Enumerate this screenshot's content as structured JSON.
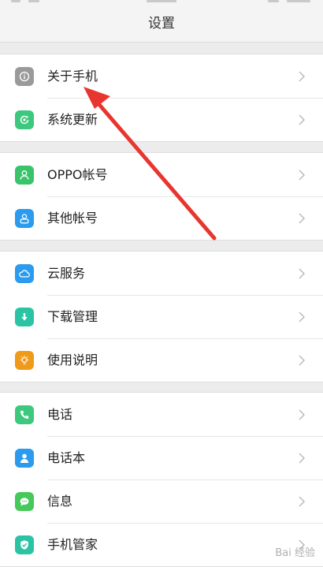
{
  "header": {
    "title": "设置"
  },
  "groups": [
    {
      "items": [
        {
          "label": "关于手机",
          "icon": "info-icon",
          "color": "#9a9a9a"
        },
        {
          "label": "系统更新",
          "icon": "update-icon",
          "color": "#3cc87d"
        }
      ]
    },
    {
      "items": [
        {
          "label": "OPPO帐号",
          "icon": "person-icon",
          "color": "#39c36b"
        },
        {
          "label": "其他帐号",
          "icon": "account-icon",
          "color": "#2a9bee"
        }
      ]
    },
    {
      "items": [
        {
          "label": "云服务",
          "icon": "cloud-icon",
          "color": "#2a9bee"
        },
        {
          "label": "下载管理",
          "icon": "download-icon",
          "color": "#2ac4a4"
        },
        {
          "label": "使用说明",
          "icon": "bulb-icon",
          "color": "#f09a1a"
        }
      ]
    },
    {
      "items": [
        {
          "label": "电话",
          "icon": "phone-icon",
          "color": "#3cc87d"
        },
        {
          "label": "电话本",
          "icon": "contacts-icon",
          "color": "#2a9bee"
        },
        {
          "label": "信息",
          "icon": "message-icon",
          "color": "#46c85a"
        },
        {
          "label": "手机管家",
          "icon": "shield-icon",
          "color": "#2ac4a4"
        }
      ]
    }
  ],
  "annotation": {
    "color": "#e8352f"
  },
  "watermark": {
    "text": "Bai 经验"
  }
}
